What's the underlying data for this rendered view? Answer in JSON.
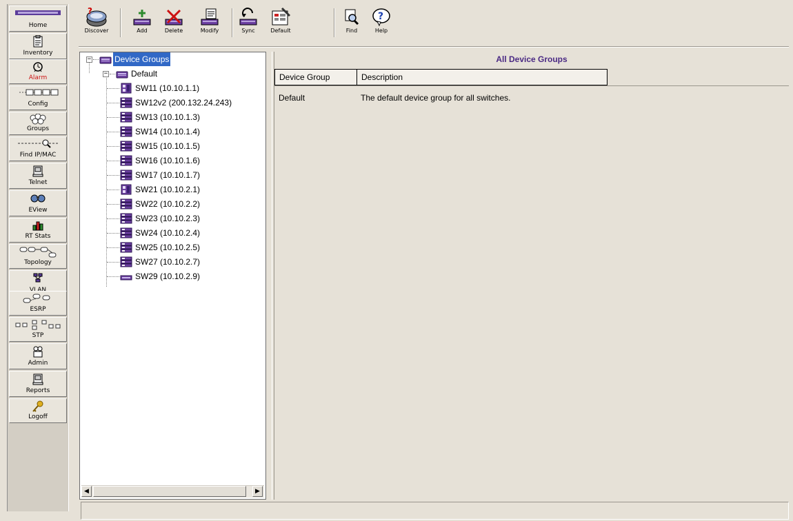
{
  "nav": {
    "items": [
      {
        "label": "Home",
        "icon": "extremeware-logo-icon"
      },
      {
        "label": "Inventory",
        "icon": "inventory-clipboard-icon"
      },
      {
        "label": "Alarm",
        "icon": "alarm-bell-icon"
      },
      {
        "label": "Config",
        "icon": "config-devices-icon"
      },
      {
        "label": "Groups",
        "icon": "groups-icon"
      },
      {
        "label": "Find IP/MAC",
        "icon": "find-ip-mac-icon"
      },
      {
        "label": "Telnet",
        "icon": "telnet-icon"
      },
      {
        "label": "EView",
        "icon": "eview-icon"
      },
      {
        "label": "RT Stats",
        "icon": "rt-stats-icon"
      },
      {
        "label": "Topology",
        "icon": "topology-icon"
      },
      {
        "label": "VLAN",
        "icon": "vlan-icon"
      },
      {
        "label": "ESRP",
        "icon": "esrp-icon"
      },
      {
        "label": "STP",
        "icon": "stp-icon"
      },
      {
        "label": "Admin",
        "icon": "admin-icon"
      },
      {
        "label": "Reports",
        "icon": "reports-icon"
      },
      {
        "label": "Logoff",
        "icon": "logoff-key-icon"
      }
    ],
    "active_label_color": "#cc1111"
  },
  "toolbar": {
    "discover": "Discover",
    "add": "Add",
    "delete": "Delete",
    "modify": "Modify",
    "sync": "Sync",
    "default": "Default",
    "find": "Find",
    "help": "Help"
  },
  "tree": {
    "root": "Device Groups",
    "group": "Default",
    "devices": [
      {
        "label": "SW11 (10.10.1.1)",
        "icon": "switch-chassis-icon"
      },
      {
        "label": "SW12v2 (200.132.24.243)",
        "icon": "switch-stack-icon"
      },
      {
        "label": "SW13 (10.10.1.3)",
        "icon": "switch-stack-icon"
      },
      {
        "label": "SW14 (10.10.1.4)",
        "icon": "switch-stack-icon"
      },
      {
        "label": "SW15 (10.10.1.5)",
        "icon": "switch-stack-icon"
      },
      {
        "label": "SW16 (10.10.1.6)",
        "icon": "switch-stack-icon"
      },
      {
        "label": "SW17 (10.10.1.7)",
        "icon": "switch-stack-icon"
      },
      {
        "label": "SW21 (10.10.2.1)",
        "icon": "switch-chassis-icon"
      },
      {
        "label": "SW22 (10.10.2.2)",
        "icon": "switch-stack-icon"
      },
      {
        "label": "SW23 (10.10.2.3)",
        "icon": "switch-stack-icon"
      },
      {
        "label": "SW24 (10.10.2.4)",
        "icon": "switch-stack-icon"
      },
      {
        "label": "SW25 (10.10.2.5)",
        "icon": "switch-stack-icon"
      },
      {
        "label": "SW27 (10.10.2.7)",
        "icon": "switch-stack-icon"
      },
      {
        "label": "SW29 (10.10.2.9)",
        "icon": "switch-flat-icon"
      }
    ]
  },
  "content": {
    "title": "All Device Groups",
    "columns": [
      "Device Group",
      "Description"
    ],
    "rows": [
      [
        "Default",
        "The default device group for all switches."
      ]
    ]
  },
  "colors": {
    "selection": "#3168c6",
    "title_purple": "#4b2a84",
    "device_purple": "#6b3fa0"
  }
}
